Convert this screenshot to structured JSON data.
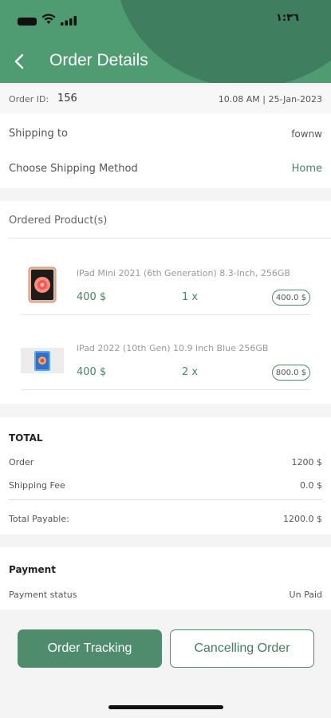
{
  "status_bar": {
    "time": "١:٣٦"
  },
  "header": {
    "title": "Order Details"
  },
  "order": {
    "id_label": "Order ID:",
    "id_value": "156",
    "date": "10.08 AM | 25-Jan-2023"
  },
  "shipping": {
    "to_label": "Shipping to",
    "to_value": "fownw",
    "method_label": "Choose Shipping Method",
    "method_value": "Home"
  },
  "products": {
    "title": "Ordered Product(s)",
    "items": [
      {
        "name": "iPad Mini 2021 (6th Generation) 8.3-Inch, 256GB",
        "price": "400 $",
        "qty": "1 x",
        "total": "400.0 $"
      },
      {
        "name": "iPad 2022 (10th Gen) 10.9 inch Blue 256GB",
        "price": "400 $",
        "qty": "2 x",
        "total": "800.0 $"
      }
    ]
  },
  "totals": {
    "title": "TOTAL",
    "order_label": "Order",
    "order_value": "1200 $",
    "shipping_label": "Shipping Fee",
    "shipping_value": "0.0 $",
    "payable_label": "Total Payable:",
    "payable_value": "1200.0 $"
  },
  "payment": {
    "title": "Payment",
    "status_label": "Payment status",
    "status_value": "Un Paid"
  },
  "actions": {
    "track_label": "Order Tracking",
    "cancel_label": "Cancelling Order"
  },
  "colors": {
    "header": "#4f9c72",
    "accent": "#3f8a63",
    "button": "#4f8c6d"
  }
}
